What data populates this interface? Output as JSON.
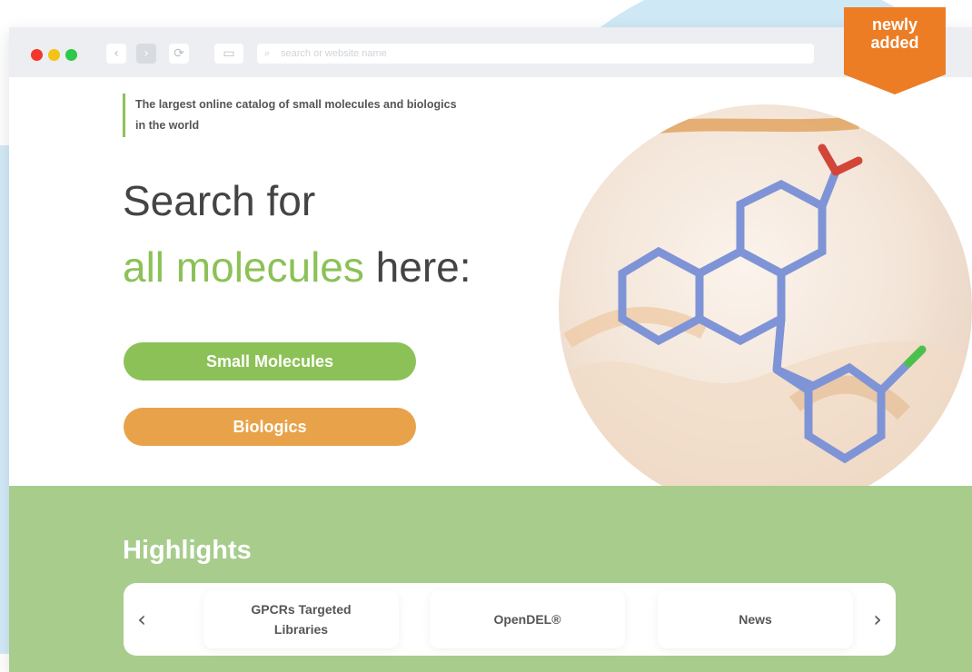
{
  "browser": {
    "address_placeholder": "search or website name"
  },
  "badge": {
    "line1": "newly",
    "line2": "added",
    "color": "#ec7d25"
  },
  "hero": {
    "tagline": "The largest online catalog of small molecules and biologics in the world",
    "heading_line1": "Search for",
    "heading_accent": "all molecules",
    "heading_rest": " here:",
    "buttons": [
      {
        "label": "Small Molecules",
        "color": "#8cc157"
      },
      {
        "label": "Biologics",
        "color": "#e8a34a"
      }
    ]
  },
  "highlights": {
    "title": "Highlights",
    "items": [
      {
        "label": "GPCRs Targeted Libraries"
      },
      {
        "label": "OpenDEL®"
      },
      {
        "label": "News"
      }
    ],
    "prev_icon": "chevron-left-icon",
    "next_icon": "chevron-right-icon"
  },
  "colors": {
    "accent_green": "#8cc157",
    "accent_orange": "#e8a34a",
    "band_green": "#a8cc8c"
  }
}
